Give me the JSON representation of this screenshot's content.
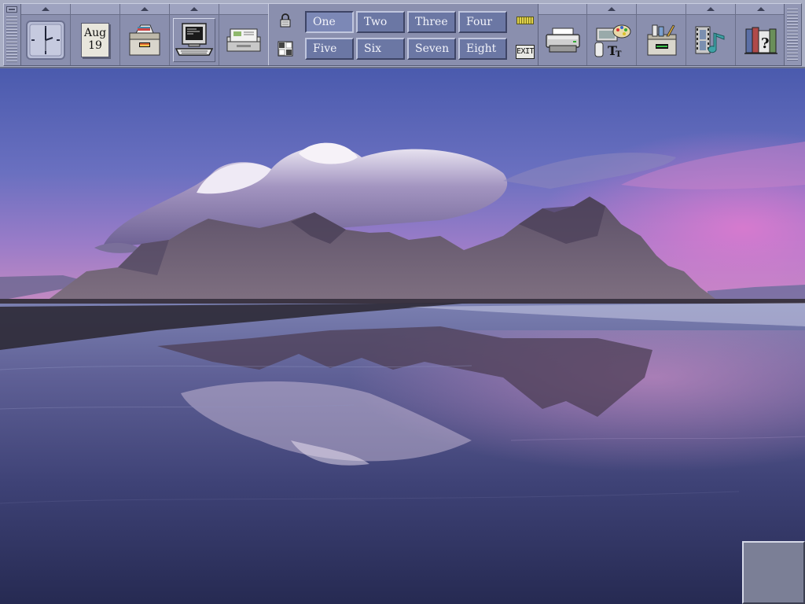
{
  "calendar": {
    "month": "Aug",
    "day": "19"
  },
  "workspaces": {
    "selected": "One",
    "row1": [
      "One",
      "Two",
      "Three",
      "Four"
    ],
    "row2": [
      "Five",
      "Six",
      "Seven",
      "Eight"
    ]
  },
  "exit": {
    "label": "EXIT"
  },
  "icons": {
    "left": [
      "clock-icon",
      "calendar-icon",
      "file-manager-icon",
      "terminal-icon",
      "mailer-icon"
    ],
    "right": [
      "printer-icon",
      "style-manager-icon",
      "application-manager-icon",
      "media-player-icon",
      "help-manager-icon"
    ],
    "switch": [
      "lock-icon",
      "workspace-grid-icon",
      "busy-light-icon"
    ]
  },
  "colors": {
    "panel": "#8a8fae",
    "workspace_button": "#6b77a4",
    "workspace_selected": "#7c88b6",
    "sky_top": "#4c5dae",
    "sky_pink": "#c77fc6"
  }
}
